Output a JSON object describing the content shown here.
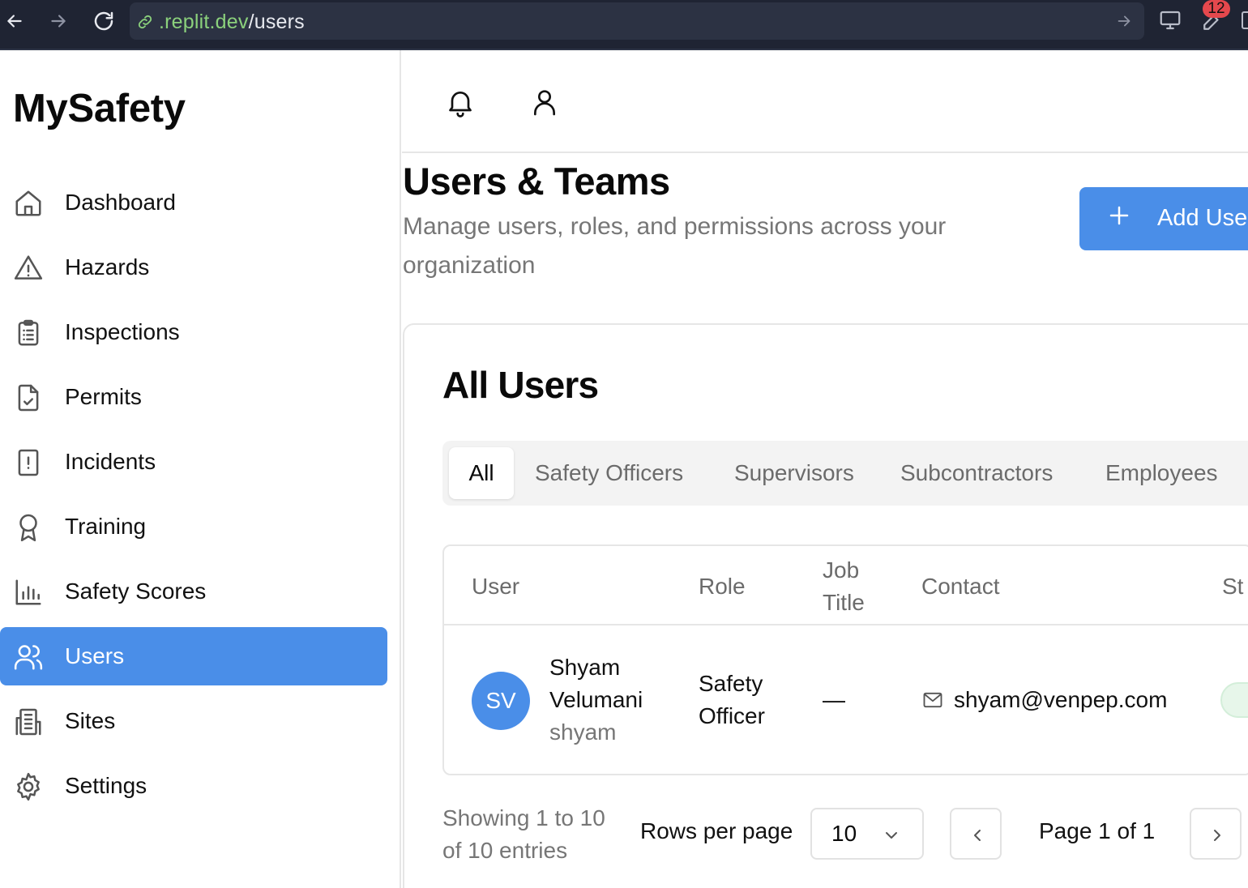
{
  "browser": {
    "url_host": ".replit.dev",
    "url_path": "/users",
    "extension_badge": "12"
  },
  "sidebar": {
    "logo": "MySafety",
    "items": [
      {
        "label": "Dashboard",
        "icon": "home-icon"
      },
      {
        "label": "Hazards",
        "icon": "warning-triangle-icon"
      },
      {
        "label": "Inspections",
        "icon": "clipboard-list-icon"
      },
      {
        "label": "Permits",
        "icon": "file-check-icon"
      },
      {
        "label": "Incidents",
        "icon": "file-alert-icon"
      },
      {
        "label": "Training",
        "icon": "award-ribbon-icon"
      },
      {
        "label": "Safety Scores",
        "icon": "bar-chart-icon"
      },
      {
        "label": "Users",
        "icon": "users-icon",
        "active": true
      },
      {
        "label": "Sites",
        "icon": "building-icon"
      },
      {
        "label": "Settings",
        "icon": "gear-icon"
      }
    ]
  },
  "header": {
    "icons": [
      "bell-icon",
      "user-icon"
    ]
  },
  "page": {
    "title": "Users & Teams",
    "subtitle": "Manage users, roles, and permissions across your organization",
    "add_button_label": "Add User"
  },
  "card": {
    "title": "All Users",
    "tabs": [
      "All",
      "Safety Officers",
      "Supervisors",
      "Subcontractors",
      "Employees"
    ],
    "active_tab": "All",
    "columns": {
      "user": "User",
      "role": "Role",
      "job_title_line1": "Job",
      "job_title_line2": "Title",
      "contact": "Contact",
      "status": "St"
    },
    "rows": [
      {
        "initials": "SV",
        "first_name": "Shyam",
        "last_name": "Velumani",
        "username": "shyam",
        "role_line1": "Safety",
        "role_line2": "Officer",
        "job_title": "—",
        "email": "shyam@venpep.com"
      }
    ]
  },
  "pagination": {
    "showing_line1": "Showing 1 to 10",
    "showing_line2": "of 10 entries",
    "rows_per_page_label": "Rows per page",
    "rows_per_page_value": "10",
    "page_text": "Page 1 of 1"
  },
  "colors": {
    "accent": "#4a8ee8",
    "chrome_bg": "#1f2433"
  }
}
